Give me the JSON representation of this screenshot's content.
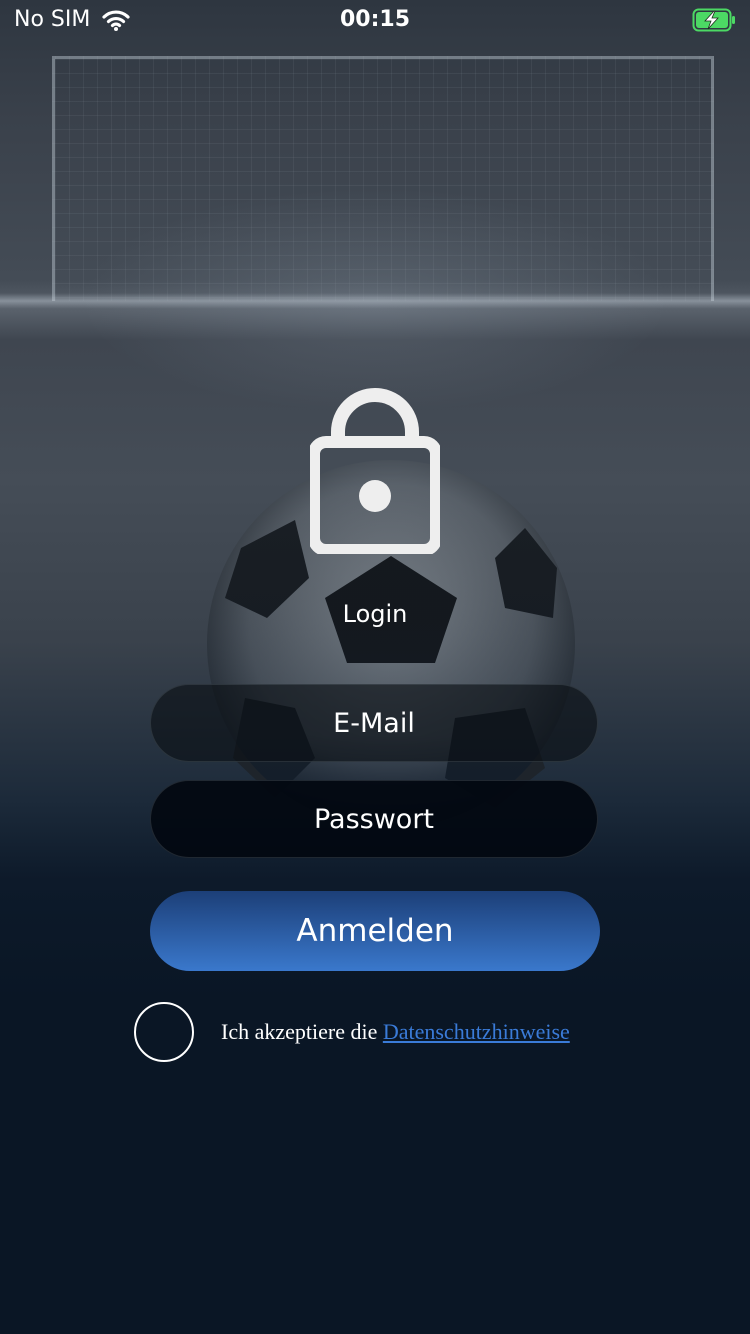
{
  "status_bar": {
    "carrier": "No SIM",
    "time": "00:15",
    "battery_state": "charging"
  },
  "icons": {
    "wifi": "wifi-icon",
    "battery": "battery-charging-icon",
    "lock": "lock-icon"
  },
  "login": {
    "title": "Login",
    "email_placeholder": "E-Mail",
    "password_placeholder": "Passwort",
    "submit_label": "Anmelden",
    "consent_prefix": "Ich akzeptiere die ",
    "consent_link": "Datenschutzhinweise"
  },
  "colors": {
    "accent": "#3a78cc",
    "link": "#3a7bd8",
    "background": "#0a1625",
    "battery_green": "#4cd964"
  }
}
